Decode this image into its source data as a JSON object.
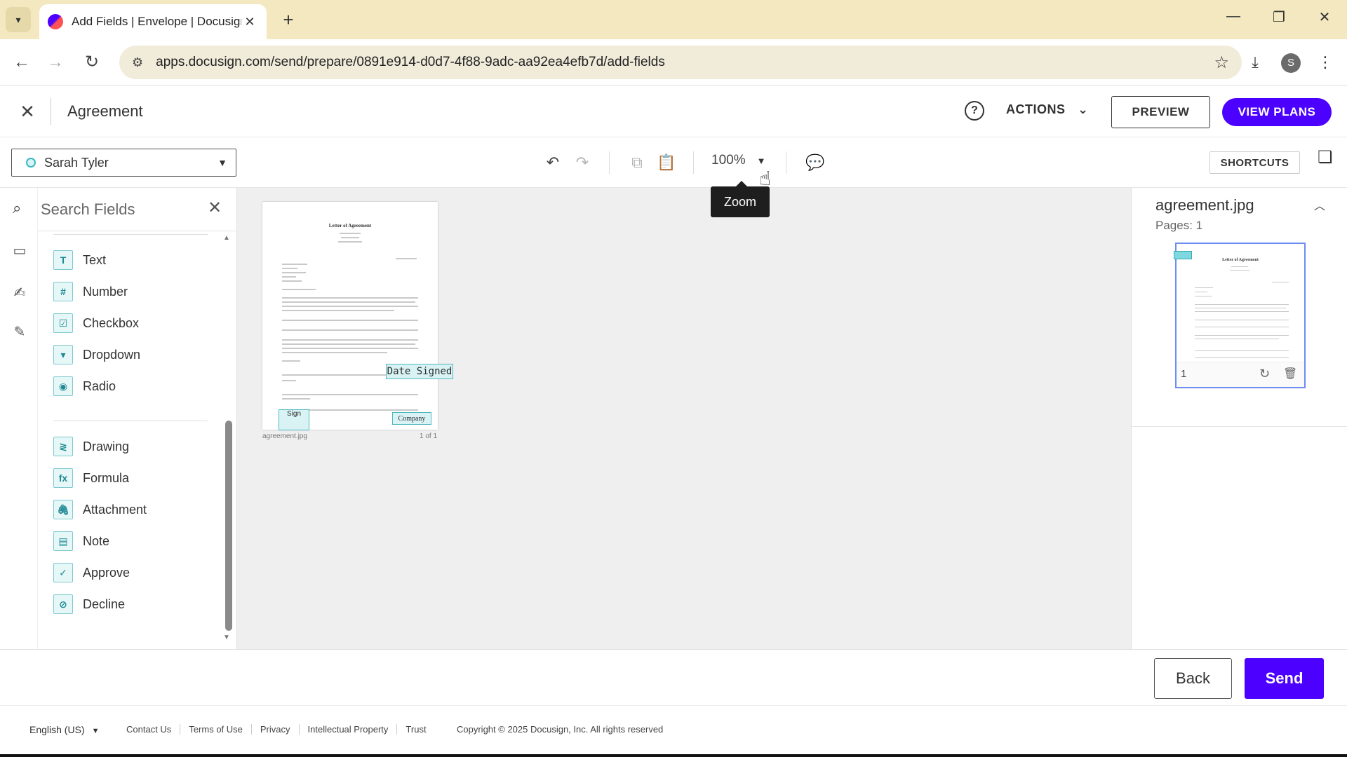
{
  "browser": {
    "tab_title": "Add Fields | Envelope | Docusign",
    "url": "apps.docusign.com/send/prepare/0891e914-d0d7-4f88-9adc-aa92ea4efb7d/add-fields",
    "profile_initial": "S"
  },
  "header": {
    "title": "Agreement",
    "actions_label": "ACTIONS",
    "preview_label": "PREVIEW",
    "view_plans_label": "VIEW PLANS"
  },
  "toolbar": {
    "recipient": "Sarah Tyler",
    "zoom_value": "100%",
    "zoom_tooltip": "Zoom",
    "shortcuts_label": "SHORTCUTS"
  },
  "fields_panel": {
    "search_placeholder": "Search Fields",
    "standard_fields": [
      {
        "label": "Text",
        "icon": "T"
      },
      {
        "label": "Number",
        "icon": "#"
      },
      {
        "label": "Checkbox",
        "icon": "☑"
      },
      {
        "label": "Dropdown",
        "icon": "▾"
      },
      {
        "label": "Radio",
        "icon": "◉"
      }
    ],
    "advanced_fields": [
      {
        "label": "Drawing",
        "icon": "≷"
      },
      {
        "label": "Formula",
        "icon": "fx"
      },
      {
        "label": "Attachment",
        "icon": "🖇"
      },
      {
        "label": "Note",
        "icon": "▤"
      },
      {
        "label": "Approve",
        "icon": "✓"
      },
      {
        "label": "Decline",
        "icon": "⊘"
      }
    ]
  },
  "document": {
    "page_title": "Letter of Agreement",
    "date_signed_tag": "Date Signed",
    "sign_tag": "Sign",
    "company_tag": "Company",
    "file_caption": "agreement.jpg",
    "page_count_caption": "1 of 1"
  },
  "right_panel": {
    "file_name": "agreement.jpg",
    "pages_label": "Pages: 1",
    "thumb_title": "Letter of Agreement",
    "thumb_page_number": "1"
  },
  "action_bar": {
    "back_label": "Back",
    "send_label": "Send"
  },
  "footer": {
    "language": "English (US)",
    "links": [
      "Contact Us",
      "Terms of Use",
      "Privacy",
      "Intellectual Property",
      "Trust"
    ],
    "copyright": "Copyright © 2025 Docusign, Inc. All rights reserved"
  },
  "colors": {
    "brand_purple": "#4c00ff",
    "field_teal": "#4fb6bf",
    "tab_strip": "#f3e8bf"
  }
}
